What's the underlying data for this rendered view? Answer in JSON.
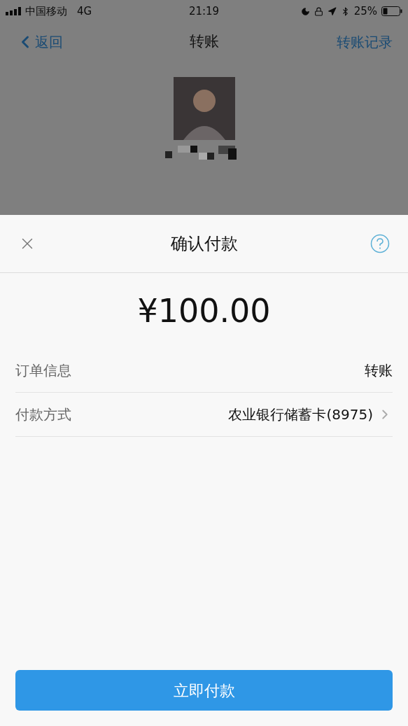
{
  "status_bar": {
    "carrier": "中国移动",
    "network": "4G",
    "time": "21:19",
    "battery": "25%"
  },
  "nav": {
    "back": "返回",
    "title": "转账",
    "action": "转账记录"
  },
  "sheet": {
    "title": "确认付款",
    "amount": "¥100.00",
    "rows": [
      {
        "label": "订单信息",
        "value": "转账",
        "kind": "plain"
      },
      {
        "label": "付款方式",
        "value": "农业银行储蓄卡(8975)",
        "kind": "link"
      }
    ],
    "button": "立即付款"
  }
}
